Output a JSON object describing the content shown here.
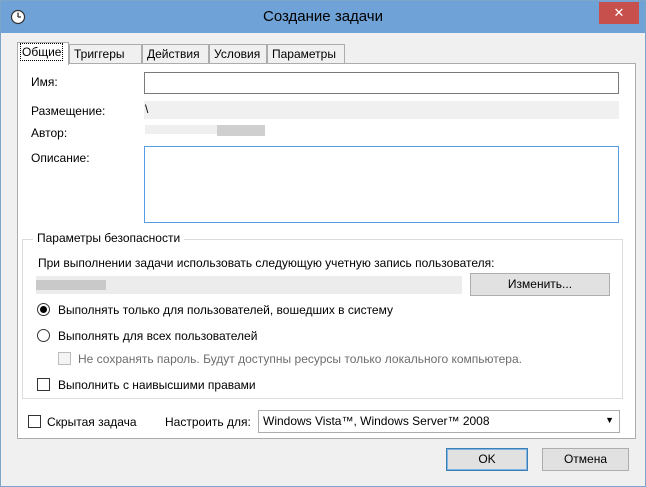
{
  "window": {
    "title": "Создание задачи",
    "close_glyph": "✕",
    "icon": "clock-icon"
  },
  "tabs": [
    {
      "label": "Общие",
      "active": true
    },
    {
      "label": "Триггеры",
      "active": false
    },
    {
      "label": "Действия",
      "active": false
    },
    {
      "label": "Условия",
      "active": false
    },
    {
      "label": "Параметры",
      "active": false
    }
  ],
  "general": {
    "name_label": "Имя:",
    "name_value": "",
    "location_label": "Размещение:",
    "location_value": "\\",
    "author_label": "Автор:",
    "description_label": "Описание:",
    "description_value": ""
  },
  "security": {
    "group_title": "Параметры безопасности",
    "run_as_text": "При выполнении задачи использовать следующую учетную запись пользователя:",
    "change_button": "Изменить...",
    "radio_logged_on": "Выполнять только для пользователей, вошедших в систему",
    "radio_logged_on_checked": true,
    "radio_all_users": "Выполнять для всех пользователей",
    "radio_all_users_checked": false,
    "no_store_password": "Не сохранять пароль. Будут доступны ресурсы только локального компьютера.",
    "highest_privileges": "Выполнить с наивысшими правами"
  },
  "bottom": {
    "hidden_task": "Скрытая задача",
    "configure_label": "Настроить для:",
    "configure_value": "Windows Vista™, Windows Server™ 2008"
  },
  "buttons": {
    "ok": "OK",
    "cancel": "Отмена"
  },
  "colors": {
    "titlebar": "#6fa2d6",
    "close": "#c7504c",
    "focus_border": "#569de5"
  }
}
